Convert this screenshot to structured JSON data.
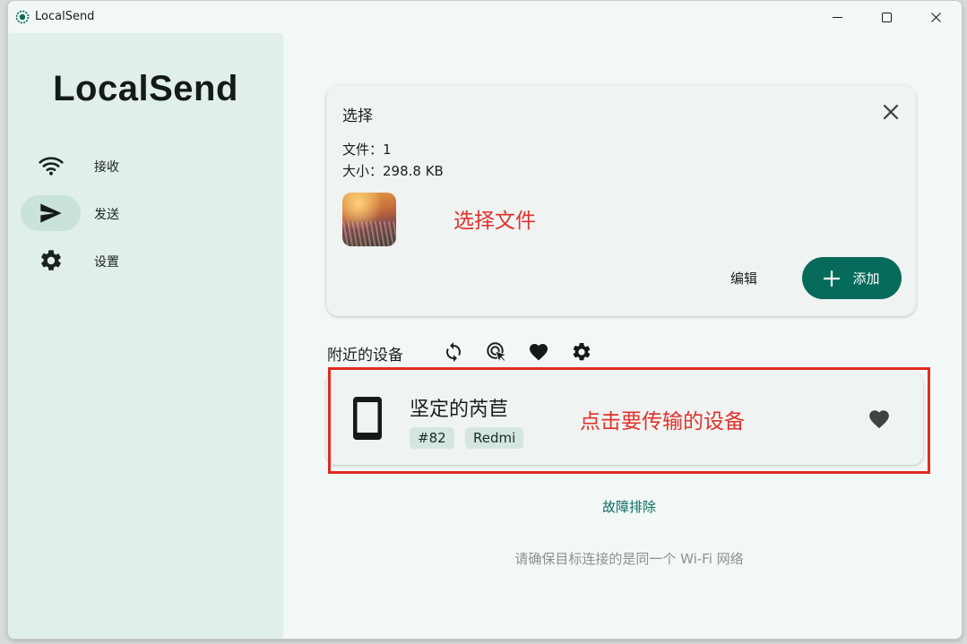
{
  "window": {
    "title": "LocalSend",
    "controls": {
      "minimize": "minimize-icon",
      "maximize": "maximize-icon",
      "close": "close-icon"
    }
  },
  "sidebar": {
    "brand": "LocalSend",
    "items": [
      {
        "label": "接收",
        "icon": "wifi-icon",
        "active": false
      },
      {
        "label": "发送",
        "icon": "send-icon",
        "active": true
      },
      {
        "label": "设置",
        "icon": "gear-icon",
        "active": false
      }
    ]
  },
  "selection": {
    "title": "选择",
    "files_line": "文件：1",
    "size_line": "大小：298.8 KB",
    "annotation": "选择文件",
    "edit_label": "编辑",
    "add_label": "添加"
  },
  "nearby": {
    "label": "附近的设备",
    "tools": [
      "refresh-icon",
      "scan-icon",
      "heart-icon",
      "gear-icon"
    ],
    "devices": [
      {
        "name": "坚定的芮苣",
        "id_tag": "#82",
        "model_tag": "Redmi",
        "icon": "phone-icon",
        "favorite": true
      }
    ],
    "annotation": "点击要传输的设备"
  },
  "footer": {
    "troubleshoot": "故障排除",
    "hint": "请确保目标连接的是同一个 Wi-Fi 网络"
  },
  "colors": {
    "accent": "#066b5b",
    "sidebar_bg": "#e1efeb",
    "main_bg": "#f2f8f6",
    "annotation_red": "#e0322b"
  }
}
